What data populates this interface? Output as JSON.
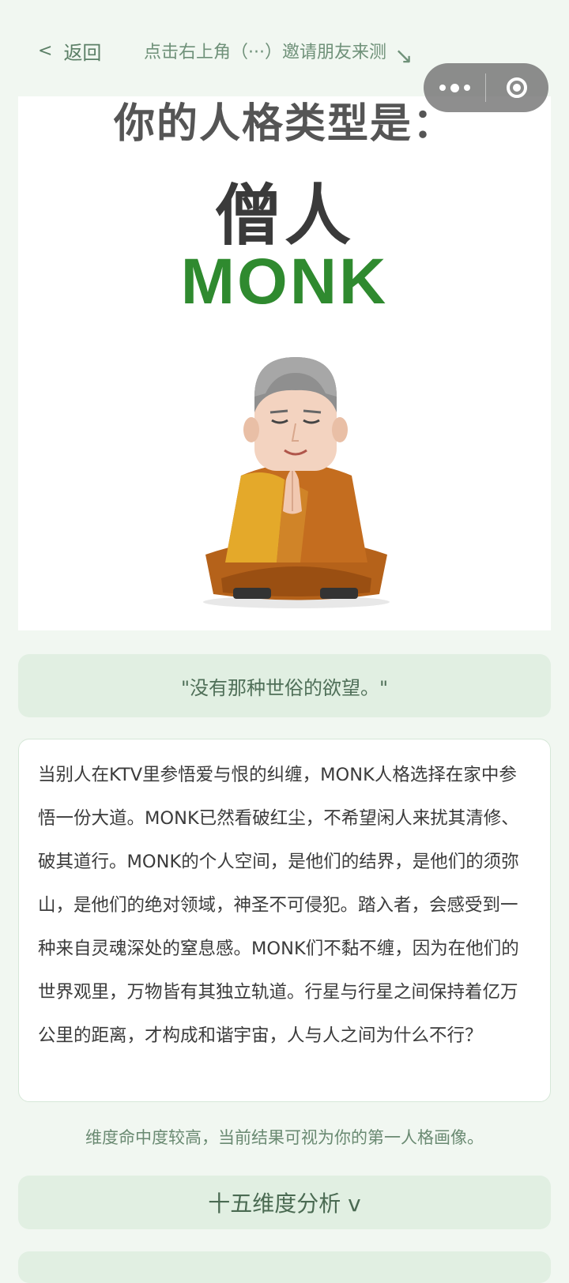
{
  "nav": {
    "back_chevron": "<",
    "back_label": "返回",
    "share_hint": "点击右上角（···）邀请朋友来测",
    "share_arrow": "↘"
  },
  "capsule": {
    "more_icon": "more-dots-icon",
    "close_icon": "target-close-icon"
  },
  "hero": {
    "title": "你的人格类型是：",
    "type_name": "僧人",
    "type_en": "MONK",
    "colors": {
      "accent_green": "#2f8a2f",
      "robe": "#c46d1f",
      "robe_light": "#e4a92a"
    }
  },
  "quote": "\"没有那种世俗的欲望。\"",
  "description": "当别人在KTV里参悟爱与恨的纠缠，MONK人格选择在家中参悟一份大道。MONK已然看破红尘，不希望闲人来扰其清修、破其道行。MONK的个人空间，是他们的结界，是他们的须弥山，是他们的绝对领域，神圣不可侵犯。踏入者，会感受到一种来自灵魂深处的窒息感。MONK们不黏不缠，因为在他们的世界观里，万物皆有其独立轨道。行星与行星之间保持着亿万公里的距离，才构成和谐宇宙，人与人之间为什么不行？",
  "note": "维度命中度较高，当前结果可视为你的第一人格画像。",
  "analysis_button": "十五维度分析 v"
}
